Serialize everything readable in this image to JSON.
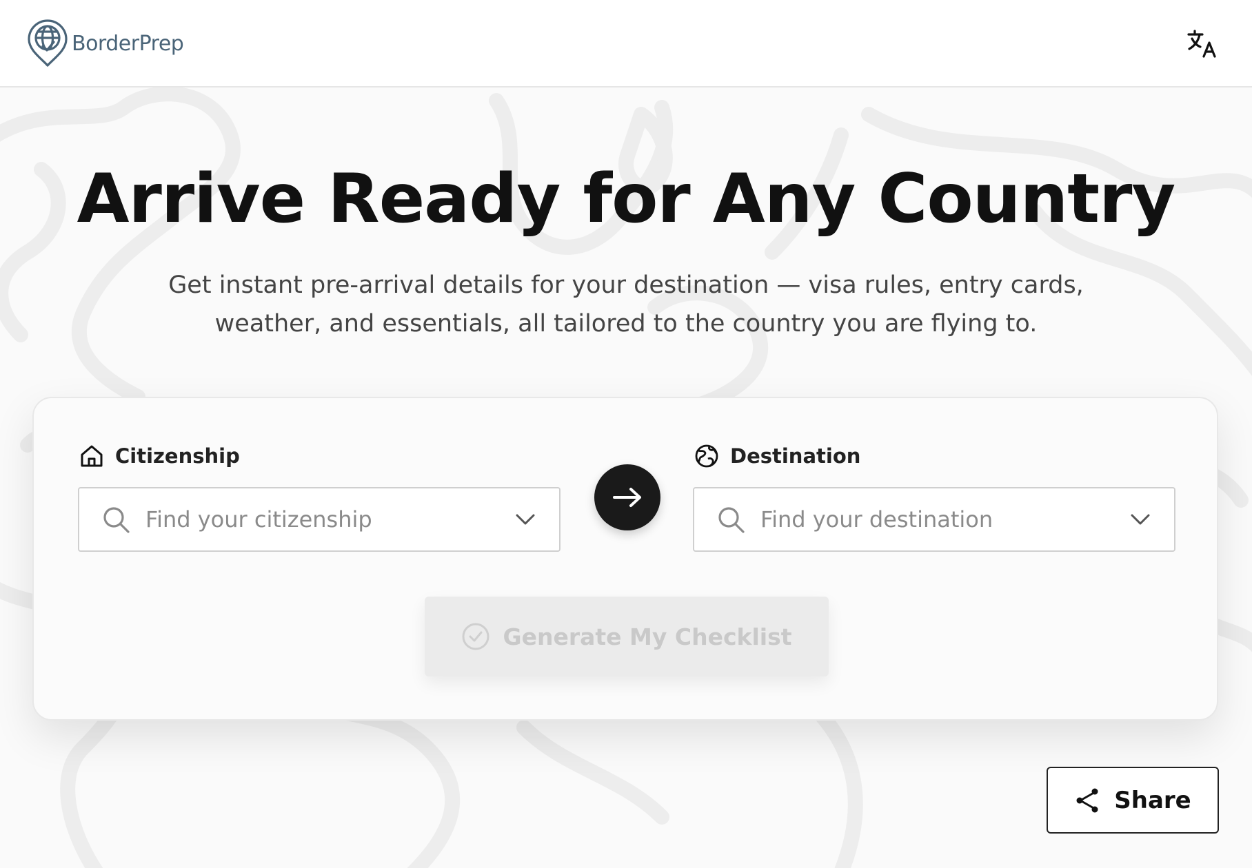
{
  "app": {
    "name": "BorderPrep"
  },
  "hero": {
    "title": "Arrive Ready for Any Country",
    "subtitle": "Get instant pre-arrival details for your destination — visa rules, entry cards, weather, and essentials, all tailored to the country you are flying to."
  },
  "form": {
    "citizenship": {
      "label": "Citizenship",
      "placeholder": "Find your citizenship",
      "value": ""
    },
    "destination": {
      "label": "Destination",
      "placeholder": "Find your destination",
      "value": ""
    },
    "generate_label": "Generate My Checklist",
    "generate_enabled": false
  },
  "share": {
    "label": "Share"
  },
  "icons": {
    "logo": "globe-pin-check-icon",
    "language": "translate-icon",
    "citizenship": "home-icon",
    "destination": "globe-icon",
    "search": "search-icon",
    "dropdown": "chevron-down-icon",
    "swap": "arrow-right-icon",
    "generate": "check-circle-icon",
    "share": "share-icon"
  },
  "colors": {
    "brand": "#4a6478",
    "primary_dark": "#1a1a1a",
    "disabled_bg": "#ebebeb",
    "disabled_text": "#c9c9c9"
  }
}
